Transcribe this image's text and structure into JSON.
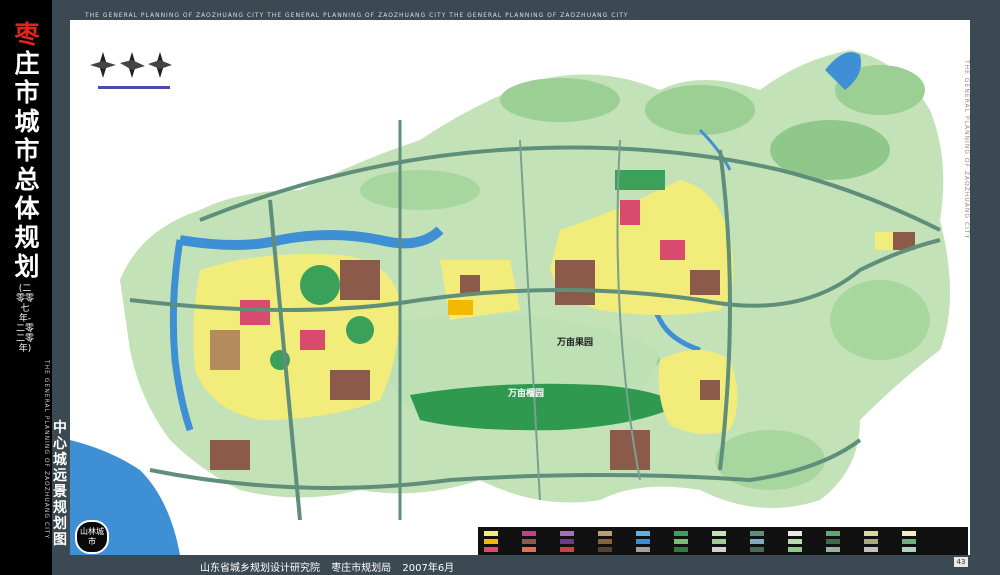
{
  "title": {
    "main_chars": [
      "枣",
      "庄",
      "市",
      "城",
      "市",
      "总",
      "体",
      "规",
      "划"
    ],
    "years": "(二零零七年-二零二零年)",
    "subtitle": "中心城远景规划图",
    "seal": "山林城市"
  },
  "texts": {
    "top_banner": "THE GENERAL PLANNING OF ZAOZHUANG CITY   THE GENERAL PLANNING OF ZAOZHUANG CITY   THE GENERAL PLANNING OF ZAOZHUANG CITY",
    "side_en": "THE GENERAL PLANNING OF ZAOZHUANG CITY",
    "right_en": "THE GENERAL PLANNING OF ZAOZHUANG CITY"
  },
  "labels": {
    "park_north": "万亩果园",
    "park_south": "万亩榴园"
  },
  "footer": {
    "institute": "山东省城乡规划设计研究院",
    "bureau": "枣庄市规划局",
    "date": "2007年6月",
    "page": "43"
  },
  "colors": {
    "residential": "#f2ec7a",
    "commercial": "#d84a6e",
    "industrial": "#8b5a4a",
    "green": "#3aa05a",
    "water": "#3f8fd4",
    "hills": "#b8dcb0",
    "road": "#5f8f7a"
  }
}
